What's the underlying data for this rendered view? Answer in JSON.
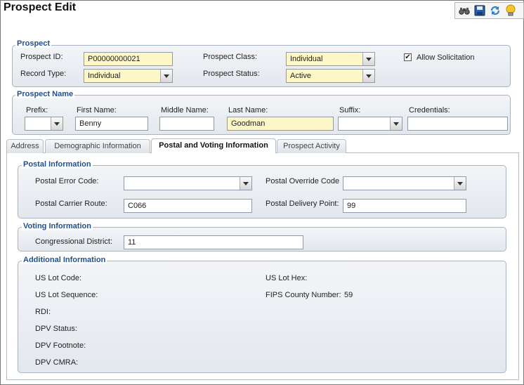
{
  "window": {
    "title": "Prospect Edit"
  },
  "toolbar": {
    "icons": [
      "binoculars-icon",
      "save-icon",
      "refresh-icon",
      "lightbulb-icon"
    ]
  },
  "prospect": {
    "legend": "Prospect",
    "id_label": "Prospect ID:",
    "id_value": "P00000000021",
    "record_type_label": "Record Type:",
    "record_type_value": "Individual",
    "class_label": "Prospect Class:",
    "class_value": "Individual",
    "status_label": "Prospect Status:",
    "status_value": "Active",
    "allow_solicitation_label": "Allow Solicitation",
    "allow_solicitation_checked": true
  },
  "name": {
    "legend": "Prospect Name",
    "prefix_label": "Prefix:",
    "prefix_value": "",
    "first_label": "First Name:",
    "first_value": "Benny",
    "middle_label": "Middle Name:",
    "middle_value": "",
    "last_label": "Last Name:",
    "last_value": "Goodman",
    "suffix_label": "Suffix:",
    "suffix_value": "",
    "credentials_label": "Credentials:",
    "credentials_value": ""
  },
  "tabs": [
    {
      "label": "Address"
    },
    {
      "label": "Demographic Information"
    },
    {
      "label": "Postal and Voting Information"
    },
    {
      "label": "Prospect Activity"
    }
  ],
  "active_tab": "Postal and Voting Information",
  "postal": {
    "legend": "Postal Information",
    "error_code_label": "Postal Error Code:",
    "error_code_value": "",
    "override_code_label": "Postal Override Code",
    "override_code_value": "",
    "carrier_route_label": "Postal Carrier Route:",
    "carrier_route_value": "C066",
    "delivery_point_label": "Postal Delivery Point:",
    "delivery_point_value": "99"
  },
  "voting": {
    "legend": "Voting Information",
    "district_label": "Congressional District:",
    "district_value": "11"
  },
  "additional": {
    "legend": "Additional Information",
    "us_lot_code_label": "US Lot Code:",
    "us_lot_hex_label": "US Lot Hex:",
    "us_lot_sequence_label": "US Lot Sequence:",
    "fips_label": "FIPS County Number:",
    "fips_value": "59",
    "rdi_label": "RDI:",
    "dpv_status_label": "DPV Status:",
    "dpv_footnote_label": "DPV Footnote:",
    "dpv_cmra_label": "DPV CMRA:"
  }
}
